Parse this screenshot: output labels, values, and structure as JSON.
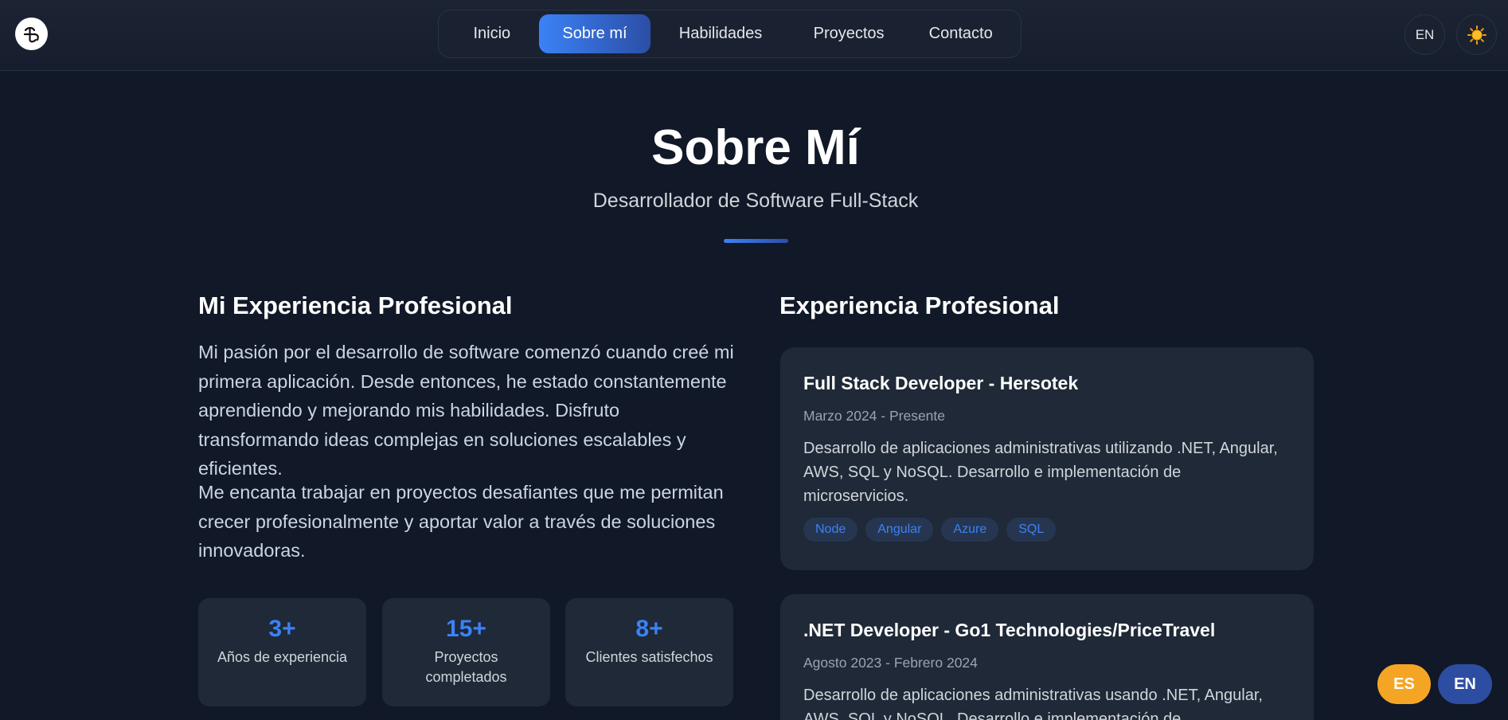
{
  "header": {
    "logo_icon": "glyph-logo-icon",
    "nav": [
      {
        "label": "Inicio",
        "active": false
      },
      {
        "label": "Sobre mí",
        "active": true
      },
      {
        "label": "Habilidades",
        "active": false
      },
      {
        "label": "Proyectos",
        "active": false
      },
      {
        "label": "Contacto",
        "active": false
      }
    ],
    "lang_toggle": "EN",
    "theme_icon": "sun-icon"
  },
  "hero": {
    "title": "Sobre Mí",
    "subtitle": "Desarrollador de Software Full-Stack"
  },
  "about": {
    "heading": "Mi Experiencia Profesional",
    "paragraphs": [
      "Mi pasión por el desarrollo de software comenzó cuando creé mi primera aplicación. Desde entonces, he estado constantemente aprendiendo y mejorando mis habilidades. Disfruto transformando ideas complejas en soluciones escalables y eficientes.",
      "Me encanta trabajar en proyectos desafiantes que me permitan crecer profesionalmente y aportar valor a través de soluciones innovadoras."
    ],
    "stats": [
      {
        "value": "3+",
        "label": "Años de experiencia"
      },
      {
        "value": "15+",
        "label": "Proyectos completados"
      },
      {
        "value": "8+",
        "label": "Clientes satisfechos"
      }
    ]
  },
  "experience": {
    "heading": "Experiencia Profesional",
    "items": [
      {
        "title": "Full Stack Developer - Hersotek",
        "date": "Marzo 2024 - Presente",
        "description": "Desarrollo de aplicaciones administrativas utilizando .NET, Angular, AWS, SQL y NoSQL. Desarrollo e implementación de microservicios.",
        "tags": [
          "Node",
          "Angular",
          "Azure",
          "SQL"
        ]
      },
      {
        "title": ".NET Developer - Go1 Technologies/PriceTravel",
        "date": "Agosto 2023 - Febrero 2024",
        "description": "Desarrollo de aplicaciones administrativas usando .NET, Angular, AWS, SQL y NoSQL. Desarrollo e implementación de"
      }
    ]
  },
  "lang_switch": {
    "es": "ES",
    "en": "EN"
  },
  "colors": {
    "background": "#111827",
    "card": "#1f2937",
    "accent": "#3b82f6",
    "accent_dark": "#2c4ea6",
    "es_button": "#f5a524",
    "en_button": "#2c4da1"
  }
}
